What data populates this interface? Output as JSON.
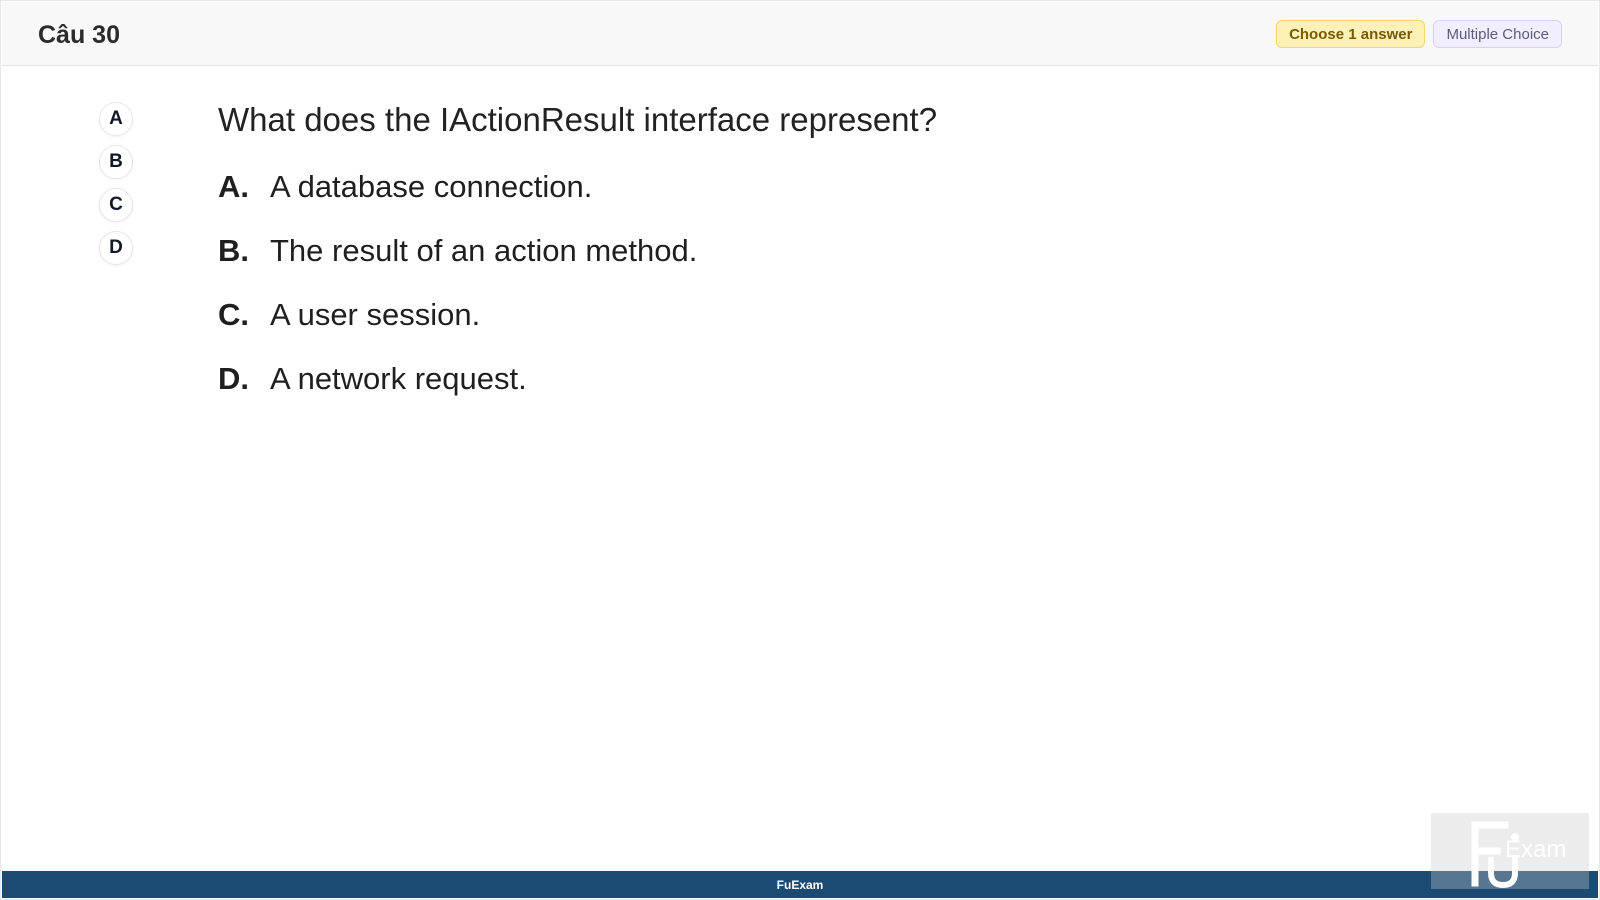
{
  "header": {
    "title": "Câu 30",
    "choose_badge": "Choose 1 answer",
    "type_badge": "Multiple Choice"
  },
  "selector": [
    "A",
    "B",
    "C",
    "D"
  ],
  "question": {
    "text": "What does the IActionResult interface represent?",
    "options": [
      {
        "letter": "A.",
        "text": "A database connection."
      },
      {
        "letter": "B.",
        "text": "The result of an action method."
      },
      {
        "letter": "C.",
        "text": "A user session."
      },
      {
        "letter": "D.",
        "text": "A network request."
      }
    ]
  },
  "footer": {
    "text": "FuExam"
  },
  "watermark": {
    "text": "Exam"
  }
}
